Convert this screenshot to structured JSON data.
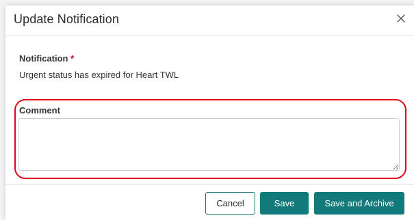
{
  "dialog": {
    "title": "Update Notification",
    "close_icon": "close-icon"
  },
  "notification": {
    "label": "Notification",
    "required_marker": "*",
    "value": "Urgent status has expired for Heart TWL"
  },
  "comment": {
    "label": "Comment",
    "value": ""
  },
  "footer": {
    "cancel_label": "Cancel",
    "save_label": "Save",
    "save_archive_label": "Save and Archive"
  },
  "colors": {
    "primary": "#137a7c",
    "required": "#d0021b",
    "highlight": "#e3001b"
  }
}
